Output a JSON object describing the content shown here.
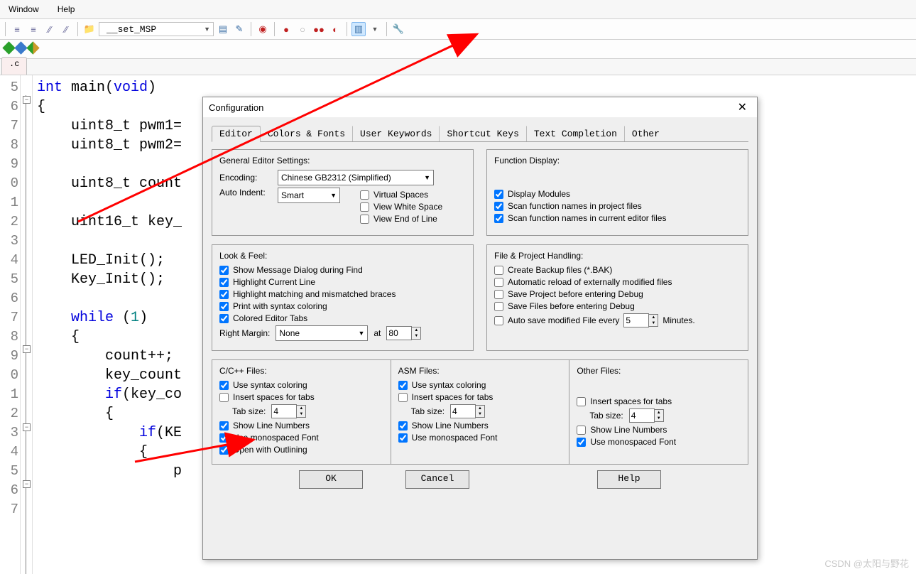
{
  "menu": {
    "window": "Window",
    "help": "Help"
  },
  "toolbar": {
    "combo_text": "__set_MSP"
  },
  "doc_tab": ".c",
  "dialog": {
    "title": "Configuration",
    "tabs": [
      "Editor",
      "Colors & Fonts",
      "User Keywords",
      "Shortcut Keys",
      "Text Completion",
      "Other"
    ],
    "general": {
      "section": "General Editor Settings:",
      "encoding_lbl": "Encoding:",
      "encoding_val": "Chinese GB2312 (Simplified)",
      "autoindent_lbl": "Auto Indent:",
      "autoindent_val": "Smart",
      "virtual_spaces": "Virtual Spaces",
      "view_ws": "View White Space",
      "view_eol": "View End of Line"
    },
    "func": {
      "section": "Function Display:",
      "disp_modules": "Display Modules",
      "scan_proj": "Scan function names in project files",
      "scan_editor": "Scan function names in current editor files"
    },
    "look": {
      "section": "Look & Feel:",
      "msg_dlg": "Show Message Dialog during Find",
      "hl_line": "Highlight Current Line",
      "hl_brace": "Highlight matching and mismatched braces",
      "syntax_print": "Print with syntax coloring",
      "colored_tabs": "Colored Editor Tabs",
      "right_margin": "Right Margin:",
      "rm_val": "None",
      "at": "at",
      "at_val": "80"
    },
    "fileproj": {
      "section": "File & Project Handling:",
      "bak": "Create Backup files (*.BAK)",
      "reload": "Automatic reload of externally modified files",
      "save_proj": "Save Project before entering Debug",
      "save_files": "Save Files before entering Debug",
      "autosave": "Auto save modified File every",
      "autosave_val": "5",
      "minutes": "Minutes."
    },
    "ccpp": {
      "section": "C/C++ Files:",
      "syntax": "Use syntax coloring",
      "spaces": "Insert spaces for tabs",
      "tabsize": "Tab size:",
      "tabsize_val": "4",
      "linenum": "Show Line Numbers",
      "mono": "Use monospaced Font",
      "outline": "Open with Outlining"
    },
    "asm": {
      "section": "ASM Files:",
      "syntax": "Use syntax coloring",
      "spaces": "Insert spaces for tabs",
      "tabsize": "Tab size:",
      "tabsize_val": "4",
      "linenum": "Show Line Numbers",
      "mono": "Use monospaced Font"
    },
    "other": {
      "section": "Other Files:",
      "spaces": "Insert spaces for tabs",
      "tabsize": "Tab size:",
      "tabsize_val": "4",
      "linenum": "Show Line Numbers",
      "mono": "Use monospaced Font"
    },
    "buttons": {
      "ok": "OK",
      "cancel": "Cancel",
      "help": "Help"
    }
  },
  "watermark": "CSDN @太阳与野花",
  "code_lines": {
    "ln5": "5",
    "ln6": "6",
    "ln7": "7",
    "ln8": "8",
    "ln9": "9",
    "ln0": "0",
    "ln1": "1",
    "ln2": "2",
    "ln3": "3",
    "ln4": "4",
    "ln5b": "5",
    "ln6b": "6",
    "ln7b": "7",
    "ln8b": "8",
    "ln9b": "9",
    "ln0b": "0",
    "ln1b": "1",
    "ln2b": "2",
    "ln3b": "3",
    "ln4b": "4",
    "ln5c": "5",
    "ln6c": "6",
    "ln7c": "7"
  }
}
